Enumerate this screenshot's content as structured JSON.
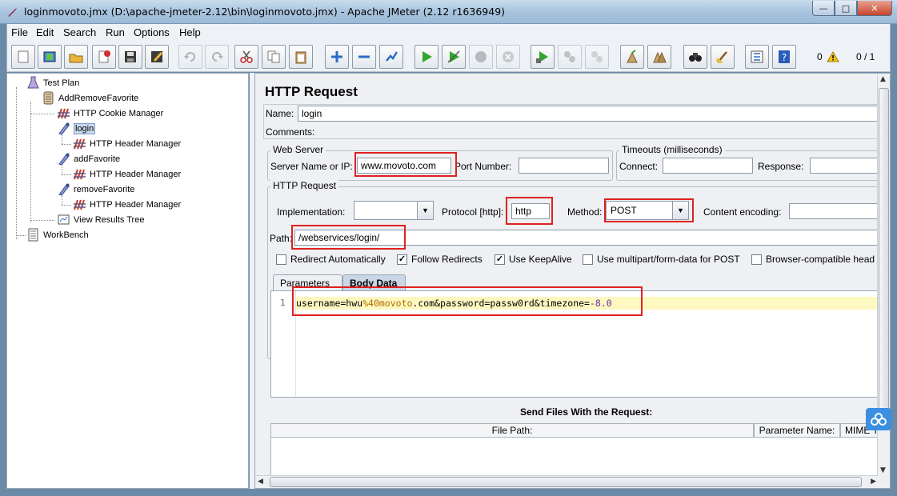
{
  "window": {
    "title": "loginmovoto.jmx (D:\\apache-jmeter-2.12\\bin\\loginmovoto.jmx) - Apache JMeter (2.12 r1636949)",
    "minimize_glyph": "—",
    "maximize_glyph": "□",
    "close_glyph": "✕"
  },
  "menu": [
    "File",
    "Edit",
    "Search",
    "Run",
    "Options",
    "Help"
  ],
  "toolbar": {
    "buttons": [
      "new-icon",
      "templates-icon",
      "open-icon",
      "close-icon",
      "save-icon",
      "save-as-icon",
      "undo-icon",
      "redo-icon",
      "cut-icon",
      "copy-icon",
      "paste-icon",
      "expand-icon",
      "collapse-icon",
      "toggle-icon",
      "start-icon",
      "start-no-pause-icon",
      "stop-icon",
      "shutdown-icon",
      "remote-start-icon",
      "remote-stop-icon",
      "remote-shutdown-icon",
      "clear-icon",
      "clear-all-icon",
      "search-icon",
      "reset-search-icon",
      "function-helper-icon",
      "help-icon"
    ],
    "error_count": "0",
    "thread_count": "0 / 1"
  },
  "tree": {
    "nodes": [
      {
        "label": "Test Plan",
        "icon": "test-plan-icon"
      },
      {
        "label": "AddRemoveFavorite",
        "icon": "thread-group-icon"
      },
      {
        "label": "HTTP Cookie Manager",
        "icon": "config-element-icon"
      },
      {
        "label": "login",
        "icon": "sampler-icon"
      },
      {
        "label": "HTTP Header Manager",
        "icon": "config-element-icon"
      },
      {
        "label": "addFavorite",
        "icon": "sampler-icon"
      },
      {
        "label": "HTTP Header Manager",
        "icon": "config-element-icon"
      },
      {
        "label": "removeFavorite",
        "icon": "sampler-icon"
      },
      {
        "label": "HTTP Header Manager",
        "icon": "config-element-icon"
      },
      {
        "label": "View Results Tree",
        "icon": "listener-icon"
      },
      {
        "label": "WorkBench",
        "icon": "workbench-icon"
      }
    ]
  },
  "form": {
    "heading": "HTTP Request",
    "name_label": "Name:",
    "name_value": "login",
    "comments_label": "Comments:",
    "web_server": {
      "title": "Web Server",
      "server_label": "Server Name or IP:",
      "server_value": "www.movoto.com",
      "port_label": "Port Number:",
      "port_value": ""
    },
    "timeouts": {
      "title": "Timeouts (milliseconds)",
      "connect_label": "Connect:",
      "connect_value": "",
      "response_label": "Response:",
      "response_value": ""
    },
    "http_request": {
      "title": "HTTP Request",
      "implementation_label": "Implementation:",
      "implementation_value": "",
      "protocol_label": "Protocol [http]:",
      "protocol_value": "http",
      "method_label": "Method:",
      "method_value": "POST",
      "encoding_label": "Content encoding:",
      "encoding_value": "",
      "path_label": "Path:",
      "path_value": "/webservices/login/"
    },
    "options": [
      {
        "label": "Redirect Automatically",
        "checked": false
      },
      {
        "label": "Follow Redirects",
        "checked": true
      },
      {
        "label": "Use KeepAlive",
        "checked": true
      },
      {
        "label": "Use multipart/form-data for POST",
        "checked": false
      },
      {
        "label": "Browser-compatible head",
        "checked": false
      }
    ],
    "tabs": {
      "parameters": "Parameters",
      "body_data": "Body Data"
    },
    "body": {
      "line_number": "1",
      "seg1": "username=hwu",
      "seg2": "%40",
      "seg3": "movoto",
      "seg4": ".com&password=passw0rd&timezone=",
      "seg5": "-8.0"
    },
    "files": {
      "title": "Send Files With the Request:",
      "col_path": "File Path:",
      "col_param": "Parameter Name:",
      "col_mime": "MIME T"
    }
  },
  "colors": {
    "highlight_box": "#e02020",
    "current_line": "#fcf8c0"
  }
}
